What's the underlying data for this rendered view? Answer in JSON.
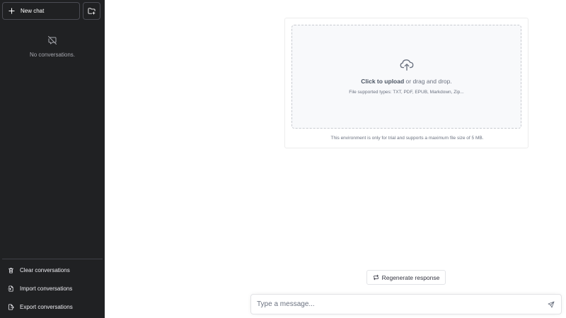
{
  "sidebar": {
    "new_chat_label": "New chat",
    "empty_text": "No conversations.",
    "footer": {
      "clear_label": "Clear conversations",
      "import_label": "Import conversations",
      "export_label": "Export conversations"
    }
  },
  "upload": {
    "click_label": "Click to upload",
    "drag_label": " or drag and drop.",
    "types_label": "File supported types: TXT, PDF, EPUB, Markdown, Zip...",
    "trial_note": "This environment is only for trial and supports a maximum file size of 5 MB."
  },
  "regenerate_label": "Regenerate response",
  "composer": {
    "placeholder": "Type a message..."
  },
  "icons": {
    "new_chat": "plus-icon",
    "new_folder": "folder-plus-icon",
    "empty": "message-off-icon",
    "clear": "trash-icon",
    "import": "file-import-icon",
    "export": "file-export-icon",
    "upload": "cloud-upload-icon",
    "regenerate": "repeat-icon",
    "send": "send-icon"
  },
  "colors": {
    "sidebar_bg": "#202123",
    "dropzone_bg": "#f8f9fb"
  }
}
